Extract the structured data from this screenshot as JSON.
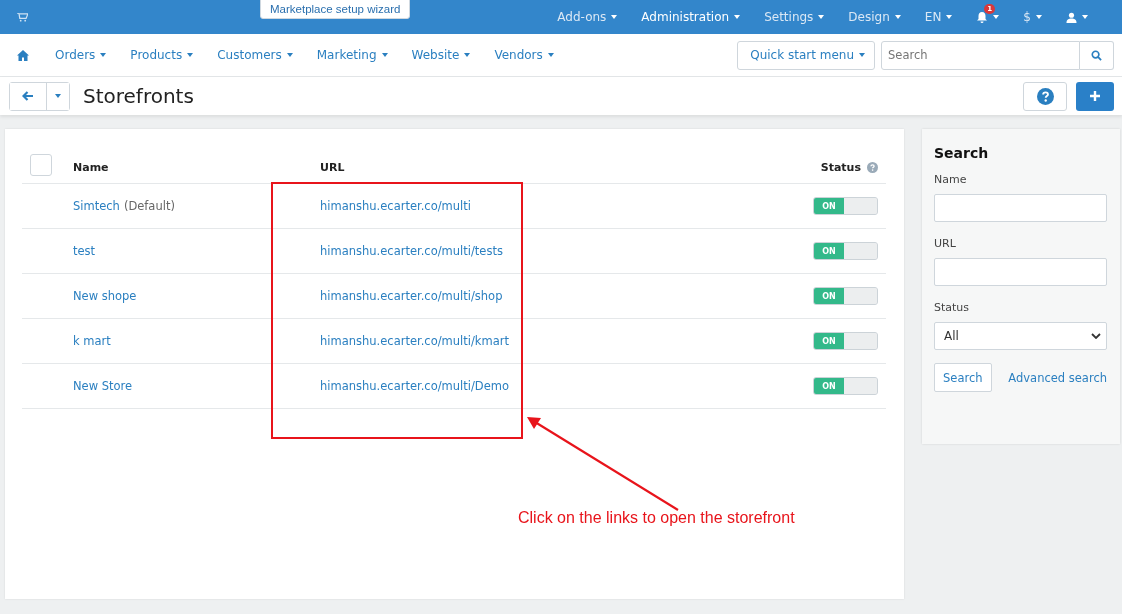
{
  "top_bar": {
    "wizard_button": "Marketplace setup wizard",
    "menus": [
      {
        "label": "Add-ons",
        "active": false
      },
      {
        "label": "Administration",
        "active": true
      },
      {
        "label": "Settings",
        "active": false
      },
      {
        "label": "Design",
        "active": false
      },
      {
        "label": "EN",
        "active": false
      }
    ],
    "notification_count": "1",
    "currency": "$"
  },
  "nav": {
    "items": [
      "Orders",
      "Products",
      "Customers",
      "Marketing",
      "Website",
      "Vendors"
    ],
    "quick_start": "Quick start menu",
    "search": {
      "placeholder": "Search"
    }
  },
  "page": {
    "title": "Storefronts"
  },
  "table": {
    "select_all": {
      "checked": false
    },
    "columns": [
      "Name",
      "URL",
      "Status"
    ],
    "rows": [
      {
        "name": "Simtech",
        "note": "(Default)",
        "url": "himanshu.ecarter.co/multi",
        "status": {
          "label": "ON",
          "on": true
        }
      },
      {
        "name": "test",
        "url": "himanshu.ecarter.co/multi/tests",
        "status": {
          "label": "ON",
          "on": true
        }
      },
      {
        "name": "New shope",
        "url": "himanshu.ecarter.co/multi/shop",
        "status": {
          "label": "ON",
          "on": true
        }
      },
      {
        "name": "k mart",
        "url": "himanshu.ecarter.co/multi/kmart",
        "status": {
          "label": "ON",
          "on": true
        }
      },
      {
        "name": "New Store",
        "url": "himanshu.ecarter.co/multi/Demo",
        "status": {
          "label": "ON",
          "on": true
        }
      }
    ]
  },
  "search_panel": {
    "title": "Search",
    "name_label": "Name",
    "url_label": "URL",
    "status_label": "Status",
    "status_value": "All",
    "search_button": "Search",
    "advanced_link": "Advanced search"
  },
  "annotation": {
    "text": "Click on the links to open the storefront"
  }
}
